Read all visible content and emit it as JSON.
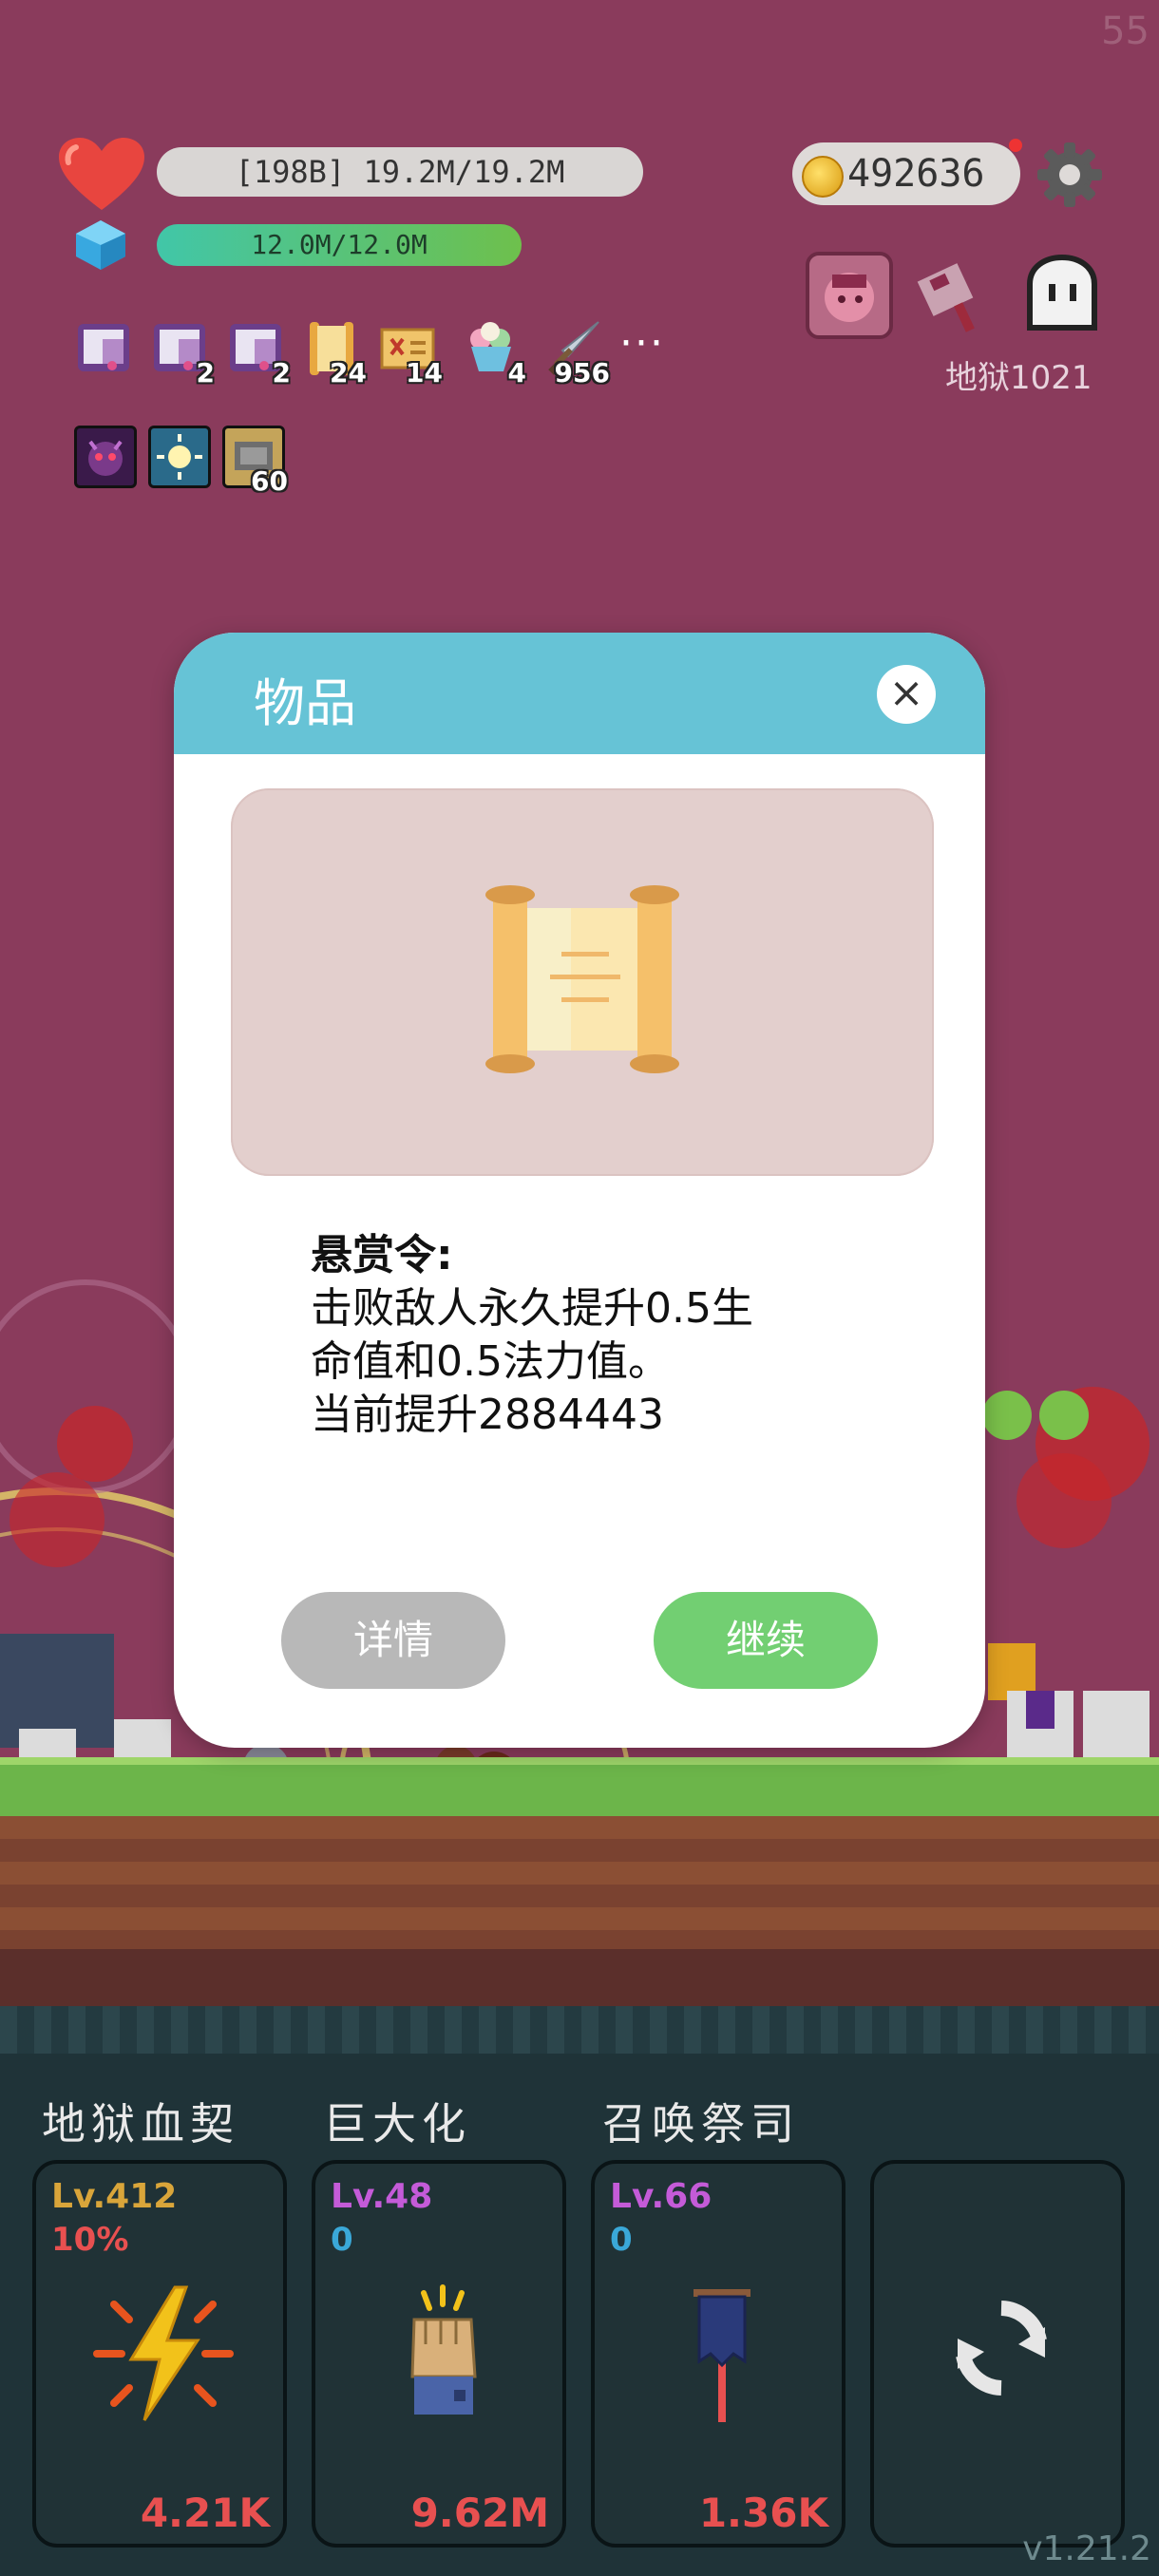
{
  "fps": "55",
  "hp_text": "[198B] 19.2M/19.2M",
  "mp_text": "12.0M/12.0M",
  "gold": "492636",
  "hell_level": "地狱1021",
  "inventory_slots": [
    {
      "icon": "pink-scroll-icon",
      "count": ""
    },
    {
      "icon": "pink-scroll-icon",
      "count": "2"
    },
    {
      "icon": "pink-scroll-icon",
      "count": "2"
    },
    {
      "icon": "bounty-scroll-icon",
      "count": "24"
    },
    {
      "icon": "map-icon",
      "count": "14"
    },
    {
      "icon": "ice-cream-icon",
      "count": "4"
    },
    {
      "icon": "sword-icon",
      "count": "956"
    }
  ],
  "more_label": "···",
  "buffs": [
    {
      "icon": "demon-buff-icon",
      "count": ""
    },
    {
      "icon": "light-buff-icon",
      "count": ""
    },
    {
      "icon": "stone-buff-icon",
      "count": "60"
    }
  ],
  "modal": {
    "title": "物品",
    "close_label": "×",
    "item_name": "悬赏令:",
    "desc_line1": "击败敌人永久提升0.5生",
    "desc_line2": "命值和0.5法力值。",
    "desc_line3": "当前提升2884443",
    "detail_label": "详情",
    "continue_label": "继续"
  },
  "skills": [
    {
      "title": "地狱血契",
      "lv": "Lv.412",
      "sub": "10%",
      "cost": "4.21K",
      "lv_color": "#d9a53a",
      "sub_color": "#e85050",
      "icon": "lightning-icon"
    },
    {
      "title": "巨大化",
      "lv": "Lv.48",
      "sub": "0",
      "cost": "9.62M",
      "lv_color": "#c45bd8",
      "sub_color": "#3aa8d8",
      "icon": "fist-icon"
    },
    {
      "title": "召唤祭司",
      "lv": "Lv.66",
      "sub": "0",
      "cost": "1.36K",
      "lv_color": "#c45bd8",
      "sub_color": "#3aa8d8",
      "icon": "banner-icon"
    }
  ],
  "refresh_icon": "refresh-icon",
  "version": "v1.21.2"
}
